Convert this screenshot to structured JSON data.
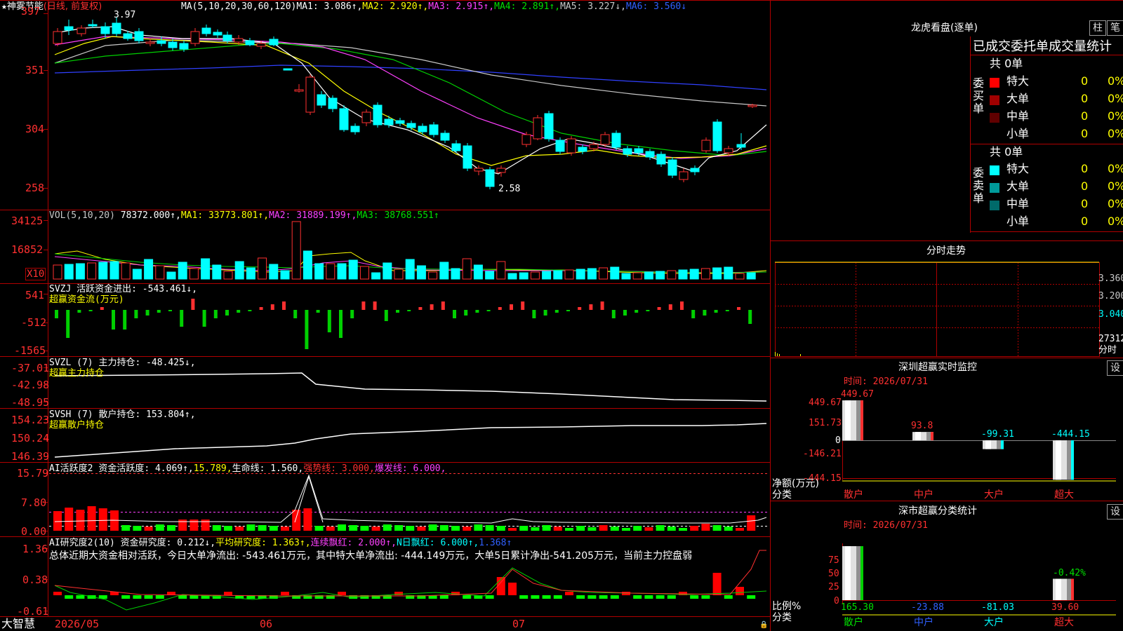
{
  "stock": {
    "name": "神雾节能",
    "mode": "(日线, 前复权)"
  },
  "main": {
    "price_axis": [
      "397",
      "351",
      "304",
      "258"
    ],
    "high_label": "3.97",
    "low_label": "2.58",
    "ma": [
      {
        "label": "MA(5,10,20,30,60,120)",
        "color": "#ffffff"
      },
      {
        "label": "MA1: 3.086↑,",
        "color": "#ffffff"
      },
      {
        "label": "MA2: 2.920↑,",
        "color": "#ffff00"
      },
      {
        "label": "MA3: 2.915↑,",
        "color": "#ff40ff"
      },
      {
        "label": "MA4: 2.891↑,",
        "color": "#00e000"
      },
      {
        "label": "MA5: 3.227↓,",
        "color": "#c8c8c8"
      },
      {
        "label": "MA6: 3.560↓",
        "color": "#3060ff"
      }
    ]
  },
  "vol": {
    "axis": [
      "34125",
      "16852"
    ],
    "unit": "X10",
    "title": "VOL(5,10,20)",
    "value": "78372.000↑,",
    "ma1": "MA1: 33773.801↑,",
    "ma2": "MA2: 31889.199↑,",
    "ma3": "MA3: 38768.551↑"
  },
  "svzj": {
    "axis": [
      "541",
      "-512",
      "-1565"
    ],
    "line1": "SVZJ  活跃资金进出: -543.461↓,",
    "line2": "超赢资金流(万元)"
  },
  "svzl": {
    "axis": [
      "-37.01",
      "-42.98",
      "-48.95"
    ],
    "line1": "SVZL (7) 主力持仓: -48.425↓,",
    "line2": "超赢主力持仓"
  },
  "svsh": {
    "axis": [
      "154.23",
      "150.24",
      "146.39"
    ],
    "line1": "SVSH (7) 散户持仓: 153.804↑,",
    "line2": "超赢散户持仓"
  },
  "ai1": {
    "axis": [
      "15.79",
      "7.80",
      "0.00"
    ],
    "name": "AI活跃度2",
    "v1": "资金活跃度: 4.069↑,",
    "v2": "15.789,",
    "v3": "生命线: 1.560,",
    "v4": "强势线: 3.000,",
    "v5": "爆发线: 6.000,"
  },
  "ai2": {
    "axis": [
      "1.36",
      "0.38",
      "-0.61"
    ],
    "name": "AI研究度2(10)",
    "v1": "资金研究度: 0.212↓,",
    "v2": "平均研究度: 1.363↑,",
    "v3": "连续飘红: 2.000↑,",
    "v4": "N日飘红: 6.000↑,",
    "v5": "1.368↑",
    "summary": "总体近期大资金相对活跃，今日大单净流出: -543.461万元，其中特大单净流出: -444.149万元，大单5日累计净出-541.205万元，当前主力控盘弱"
  },
  "dates": [
    "2026/05",
    "06",
    "07"
  ],
  "brand": "大智慧",
  "longhu": {
    "title": "龙虎看盘(逐单)",
    "btn_col": "柱",
    "btn_bi": "笔",
    "subtitle": "已成交委托单成交量统计",
    "buy_label": "委买单",
    "sell_label": "委卖单",
    "buy_total": "共 0单",
    "sell_total": "共 0单",
    "buy_rows": [
      {
        "name": "特大",
        "count": "0",
        "pct": "0%",
        "color": "#ff0000"
      },
      {
        "name": "大单",
        "count": "0",
        "pct": "0%",
        "color": "#a00000"
      },
      {
        "name": "中单",
        "count": "0",
        "pct": "0%",
        "color": "#600000"
      },
      {
        "name": "小单",
        "count": "0",
        "pct": "0%",
        "color": ""
      }
    ],
    "sell_rows": [
      {
        "name": "特大",
        "count": "0",
        "pct": "0%",
        "color": "#00ffff"
      },
      {
        "name": "大单",
        "count": "0",
        "pct": "0%",
        "color": "#009a9a"
      },
      {
        "name": "中单",
        "count": "0",
        "pct": "0%",
        "color": "#006a6a"
      },
      {
        "name": "小单",
        "count": "0",
        "pct": "0%",
        "color": ""
      }
    ]
  },
  "intraday": {
    "title": "分时走势",
    "axis": [
      "3.360",
      "3.200",
      "3.040",
      "27312"
    ],
    "unit": "分时"
  },
  "sz_monitor": {
    "title": "深圳超赢实时监控",
    "settings": "设",
    "time": "时间: 2026/07/31",
    "axis": [
      "449.67",
      "151.73",
      "0",
      "-146.21",
      "-444.15"
    ],
    "ylabel": "净额(万元)",
    "xlabel": "分类",
    "bars": [
      {
        "name": "散户",
        "value": 449.67,
        "label": "449.67"
      },
      {
        "name": "中户",
        "value": 93.8,
        "label": "93.8"
      },
      {
        "name": "大户",
        "value": -99.31,
        "label": "-99.31"
      },
      {
        "name": "超大",
        "value": -444.15,
        "label": "-444.15"
      }
    ]
  },
  "sz_category": {
    "title": "深市超赢分类统计",
    "settings": "设",
    "time": "时间: 2026/07/31",
    "axis": [
      "75",
      "50",
      "25",
      "0"
    ],
    "ylabel": "比例%",
    "xlabel": "分类",
    "bars": [
      {
        "name": "散户",
        "value": 100,
        "label": "165.30"
      },
      {
        "name": "中户",
        "value": 0,
        "label": "-23.88"
      },
      {
        "name": "大户",
        "value": 0,
        "label": "-81.03"
      },
      {
        "name": "超大",
        "value": 39.6,
        "label": "39.60"
      }
    ],
    "top_label": "-0.42%"
  }
}
